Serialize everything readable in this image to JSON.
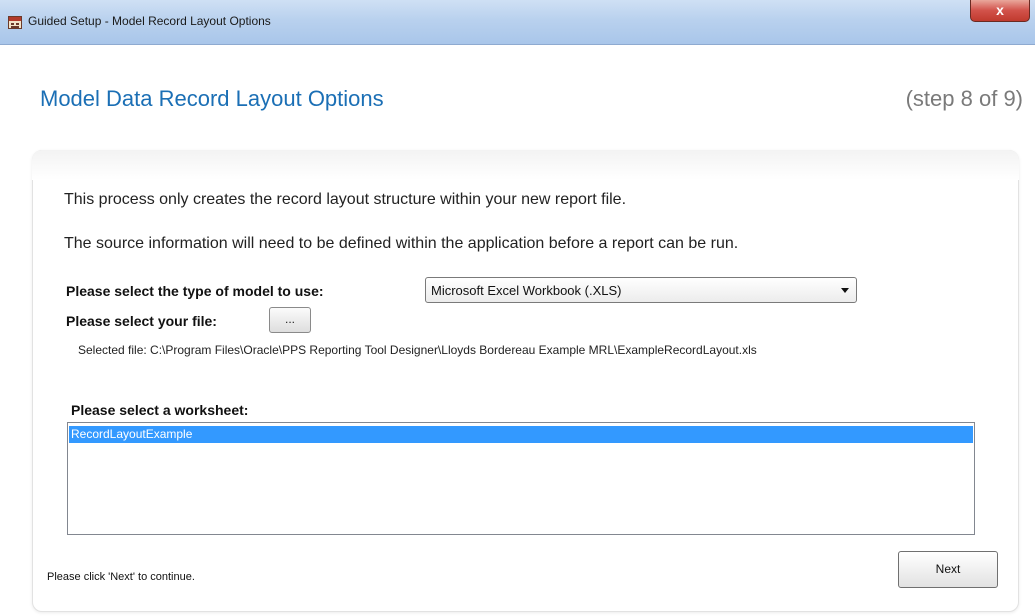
{
  "window": {
    "title": "Guided Setup - Model Record Layout Options",
    "close_label": "x"
  },
  "header": {
    "title": "Model Data Record Layout Options",
    "step": "(step 8 of 9)"
  },
  "content": {
    "info_line_1": "This process only creates the record layout structure within your new report file.",
    "info_line_2": "The source information will need to be defined within the application before a report can be run.",
    "model_label": "Please select the type of model to use:",
    "model_selected": "Microsoft Excel Workbook (.XLS)",
    "file_label": "Please select your file:",
    "browse_label": "...",
    "selected_file": "Selected file: C:\\Program Files\\Oracle\\PPS Reporting Tool Designer\\Lloyds Bordereau Example MRL\\ExampleRecordLayout.xls",
    "worksheet_label": "Please select a worksheet:",
    "worksheets": [
      "RecordLayoutExample"
    ]
  },
  "footer": {
    "hint": "Please click 'Next' to continue.",
    "next_label": "Next"
  },
  "colors": {
    "heading": "#1b6fb5",
    "selection": "#3399ff"
  }
}
